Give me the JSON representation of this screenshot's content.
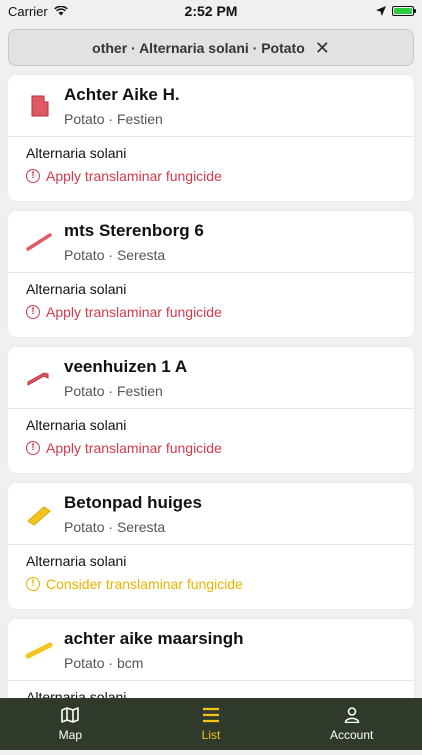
{
  "status_bar": {
    "carrier": "Carrier",
    "time": "2:52 PM"
  },
  "filter": {
    "label": "other · Alternaria solani · Potato",
    "close_icon": "close-icon"
  },
  "fields": [
    {
      "name": "Achter Aike H.",
      "crop": "Potato",
      "variety": "Festien",
      "shape_color": "#e05a66",
      "disease": "Alternaria solani",
      "advice": "Apply translaminar fungicide",
      "advice_color": "#d43a4c"
    },
    {
      "name": "mts Sterenborg 6",
      "crop": "Potato",
      "variety": "Seresta",
      "shape_color": "#e05a66",
      "disease": "Alternaria solani",
      "advice": "Apply translaminar fungicide",
      "advice_color": "#d43a4c"
    },
    {
      "name": "veenhuizen 1 A",
      "crop": "Potato",
      "variety": "Festien",
      "shape_color": "#e05a66",
      "disease": "Alternaria solani",
      "advice": "Apply translaminar fungicide",
      "advice_color": "#d43a4c"
    },
    {
      "name": "Betonpad huiges",
      "crop": "Potato",
      "variety": "Seresta",
      "shape_color": "#f2c61f",
      "disease": "Alternaria solani",
      "advice": "Consider translaminar fungicide",
      "advice_color": "#e8b400"
    },
    {
      "name": "achter aike maarsingh",
      "crop": "Potato",
      "variety": "bcm",
      "shape_color": "#f2c61f",
      "disease": "Alternaria solani",
      "advice": "",
      "advice_color": "#e8b400"
    }
  ],
  "separator": "·",
  "tabs": [
    {
      "label": "Map",
      "icon": "map-icon",
      "active": false
    },
    {
      "label": "List",
      "icon": "list-icon",
      "active": true
    },
    {
      "label": "Account",
      "icon": "account-icon",
      "active": false
    }
  ],
  "colors": {
    "tab_bar": "#2f3a2b",
    "tab_active": "#f4c313"
  }
}
